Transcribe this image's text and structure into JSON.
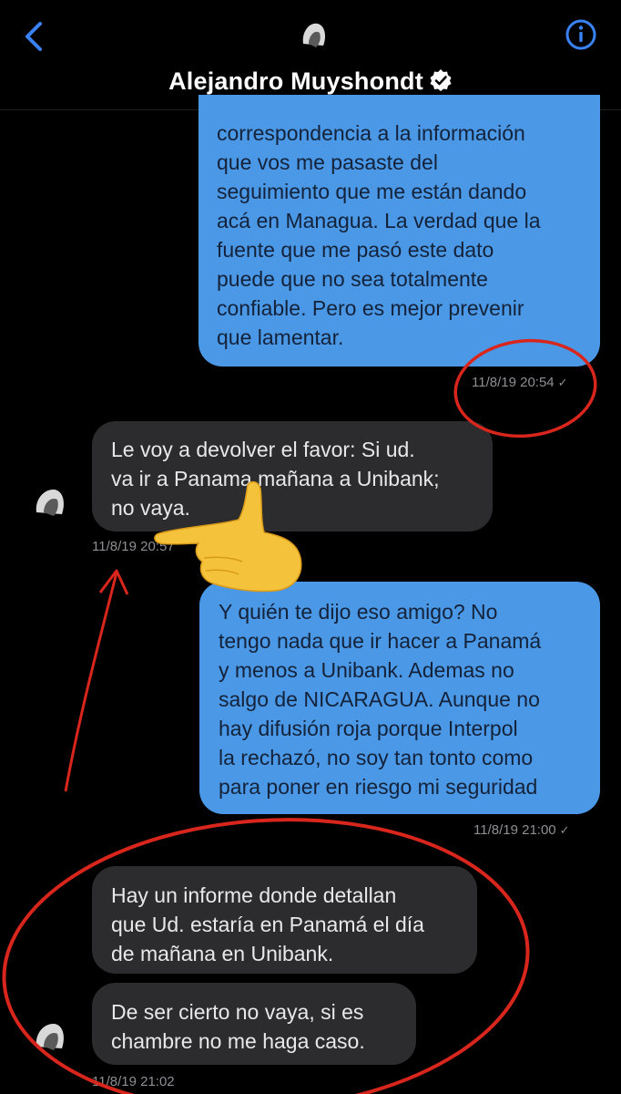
{
  "header": {
    "contact_name": "Alejandro Muyshondt"
  },
  "messages": [
    {
      "lines": [
        "correspondencia a la información",
        "que vos me pasaste del",
        "seguimiento que me están dando",
        "acá en Managua. La verdad que la",
        "fuente que me pasó este dato",
        "puede que no sea totalmente",
        "confiable. Pero es mejor prevenir",
        "que lamentar."
      ],
      "timestamp": "11/8/19 20:54"
    },
    {
      "lines": [
        "Le voy a devolver el favor: Si ud.",
        "va ir a Panama mañana a Unibank;",
        "no vaya."
      ],
      "timestamp": "11/8/19 20:57"
    },
    {
      "lines": [
        "Y quién te dijo eso amigo? No",
        "tengo nada que ir hacer a Panamá",
        "y menos a Unibank. Ademas no",
        "salgo de NICARAGUA. Aunque no",
        "hay difusión roja porque Interpol",
        "la rechazó, no soy tan tonto como",
        "para poner en riesgo mi seguridad"
      ],
      "timestamp": "11/8/19 21:00"
    },
    {
      "lines": [
        "Hay un informe donde detallan",
        "que Ud. estaría en Panamá el día",
        "de mañana en Unibank."
      ]
    },
    {
      "lines": [
        "De ser cierto no vaya, si es",
        "chambre no me haga caso."
      ],
      "timestamp": "11/8/19 21:02"
    }
  ],
  "colors": {
    "background": "#000000",
    "outgoing_bubble": "#4a98e6",
    "incoming_bubble": "#2c2c2e",
    "accent": "#3a82f7",
    "annotation_red": "#d9261c"
  },
  "icons": [
    "back-chevron-icon",
    "info-icon",
    "verified-badge-icon",
    "read-check-icon",
    "pointing-hand-emoji"
  ]
}
